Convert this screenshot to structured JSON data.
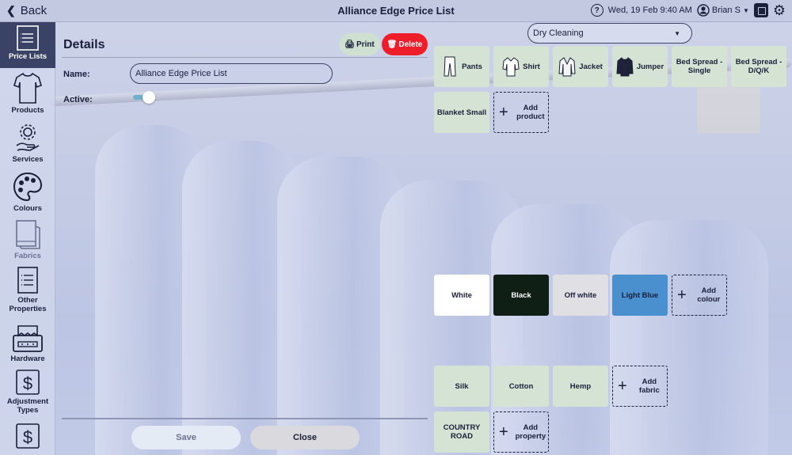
{
  "topbar": {
    "back_label": "Back",
    "title": "Alliance Edge Price List",
    "help_glyph": "?",
    "datetime": "Wed, 19 Feb 9:40 AM",
    "user": "Brian S"
  },
  "sidebar": {
    "items": [
      {
        "label": "Price Lists",
        "icon": "list-icon",
        "active": true
      },
      {
        "label": "Products",
        "icon": "tshirt-icon"
      },
      {
        "label": "Services",
        "icon": "gear-hand-icon"
      },
      {
        "label": "Colours",
        "icon": "palette-icon"
      },
      {
        "label": "Fabrics",
        "icon": "fabric-swatch-icon",
        "dim": true
      },
      {
        "label": "Other Properties",
        "icon": "list-icon"
      },
      {
        "label": "Hardware",
        "icon": "printer-icon"
      },
      {
        "label": "Adjustment Types",
        "icon": "dollar-icon"
      },
      {
        "label": "",
        "icon": "dollar-icon"
      }
    ]
  },
  "details": {
    "title": "Details",
    "print_label": "Print",
    "delete_label": "Delete",
    "name_label": "Name:",
    "name_value": "Alliance Edge Price List",
    "active_label": "Active:",
    "active": true,
    "save_label": "Save",
    "close_label": "Close"
  },
  "service_select": {
    "value": "Dry Cleaning"
  },
  "products": [
    {
      "label": "Pants",
      "icon": "pants-icon"
    },
    {
      "label": "Shirt",
      "icon": "shirt-icon"
    },
    {
      "label": "Jacket",
      "icon": "jacket-icon"
    },
    {
      "label": "Jumper",
      "icon": "jumper-icon"
    },
    {
      "label": "Bed Spread - Single"
    },
    {
      "label": "Bed Spread - D/Q/K"
    },
    {
      "label": "Blanket Small"
    }
  ],
  "add_product_label": "Add product",
  "colours": [
    {
      "label": "White",
      "color": "#ffffff",
      "text": "#1a1f3a"
    },
    {
      "label": "Black",
      "color": "#0f1f16",
      "text": "#ffffff"
    },
    {
      "label": "Off white",
      "color": "#e0e0e4",
      "text": "#1a1f3a"
    },
    {
      "label": "Light Blue",
      "color": "#4a90cf",
      "text": "#1a1f3a"
    }
  ],
  "add_colour_label": "Add colour",
  "fabrics": [
    {
      "label": "Silk"
    },
    {
      "label": "Cotton"
    },
    {
      "label": "Hemp"
    }
  ],
  "add_fabric_label": "Add fabric",
  "properties": [
    {
      "label": "COUNTRY ROAD"
    }
  ],
  "add_property_label": "Add property"
}
